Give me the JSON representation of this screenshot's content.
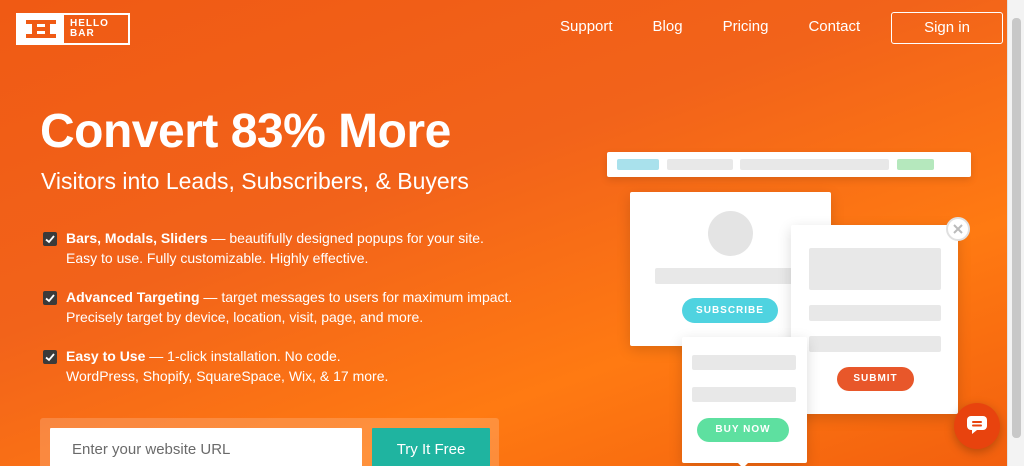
{
  "brand": {
    "logo_text_line1": "HELLO",
    "logo_text_line2": "BAR",
    "accent": "#f2631a"
  },
  "nav": {
    "items": [
      {
        "label": "Support"
      },
      {
        "label": "Blog"
      },
      {
        "label": "Pricing"
      },
      {
        "label": "Contact"
      }
    ],
    "signin_label": "Sign in"
  },
  "hero": {
    "headline": "Convert 83% More",
    "subhead": "Visitors into Leads, Subscribers, & Buyers",
    "features": [
      {
        "title": "Bars, Modals, Sliders",
        "text": " — beautifully designed popups for your site.",
        "line2": "Easy to use. Fully customizable. Highly effective."
      },
      {
        "title": "Advanced Targeting",
        "text": " — target messages to users for maximum impact.",
        "line2": "Precisely target by device, location, visit, page, and more."
      },
      {
        "title": "Easy to Use",
        "text": " — 1-click installation. No code.",
        "line2": "WordPress, Shopify, SquareSpace, Wix, & 17 more."
      }
    ]
  },
  "form": {
    "url_placeholder": "Enter your website URL",
    "url_value": "",
    "try_label": "Try It Free"
  },
  "illustration": {
    "subscribe_label": "SUBSCRIBE",
    "submit_label": "SUBMIT",
    "buynow_label": "BUY NOW",
    "subscribe_color": "#4fd3e0",
    "submit_color": "#e8572a",
    "buynow_color": "#5ee0a0"
  },
  "chat": {
    "icon": "chat-icon"
  }
}
